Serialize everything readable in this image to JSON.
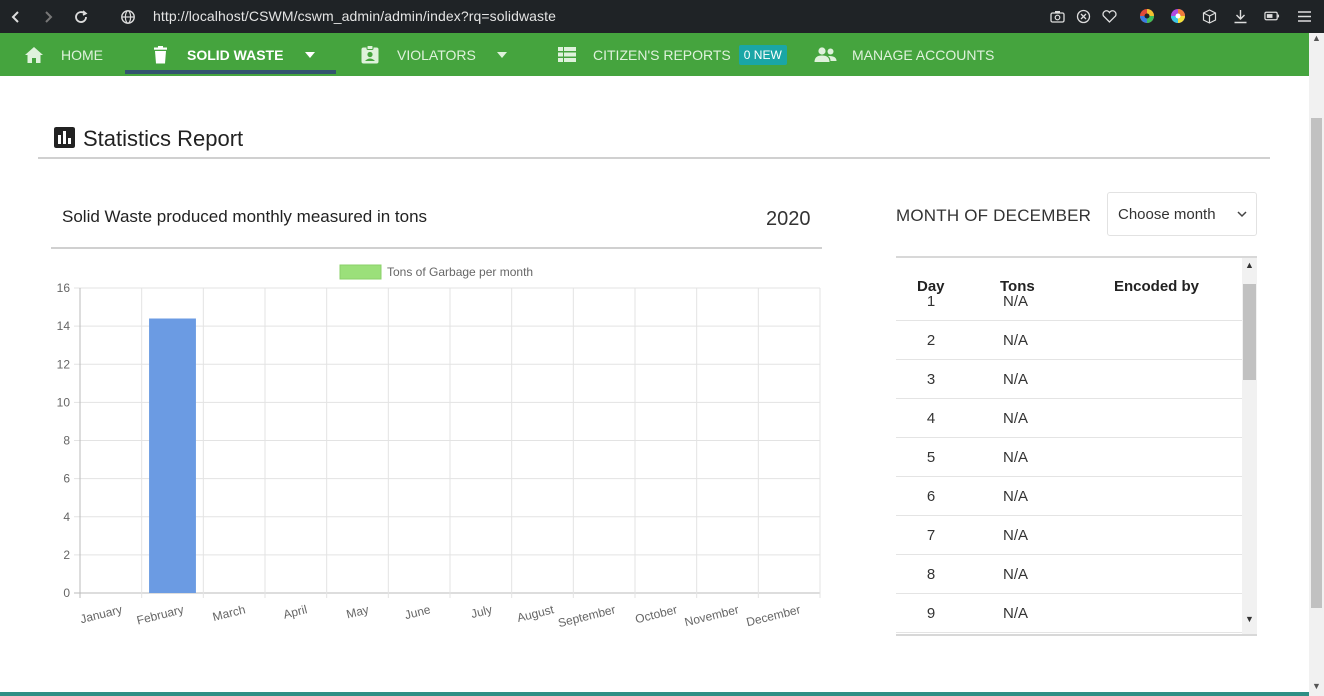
{
  "browser": {
    "url": "http://localhost/CSWM/cswm_admin/admin/index?rq=solidwaste"
  },
  "nav": {
    "items": [
      {
        "label": "HOME",
        "icon": "home-icon"
      },
      {
        "label": "SOLID WASTE",
        "icon": "trash-icon",
        "active": true,
        "dropdown": true
      },
      {
        "label": "VIOLATORS",
        "icon": "id-badge-icon",
        "dropdown": true
      },
      {
        "label": "CITIZEN'S REPORTS",
        "icon": "table-icon",
        "badge": "0 NEW"
      },
      {
        "label": "MANAGE ACCOUNTS",
        "icon": "users-icon"
      }
    ],
    "colors": {
      "bar": "#45a43e",
      "active_underline": "#33546e",
      "badge": "#1aa6a6"
    }
  },
  "page": {
    "title": "Statistics Report",
    "title_icon": "bar-chart-icon"
  },
  "chart_card": {
    "title": "Solid Waste produced monthly measured in tons",
    "year": "2020"
  },
  "chart_data": {
    "type": "bar",
    "categories": [
      "January",
      "February",
      "March",
      "April",
      "May",
      "June",
      "July",
      "August",
      "September",
      "October",
      "November",
      "December"
    ],
    "series": [
      {
        "name": "Tons of Garbage per month",
        "values": [
          0,
          14.4,
          0,
          0,
          0,
          0,
          0,
          0,
          0,
          0,
          0,
          0
        ],
        "color": "#6b9be3",
        "legend_color": "#9be07a"
      }
    ],
    "ylim": [
      0,
      16
    ],
    "yticks": [
      0,
      2,
      4,
      6,
      8,
      10,
      12,
      14,
      16
    ],
    "grid": true,
    "legend_position": "top"
  },
  "month_panel": {
    "heading": "MONTH OF DECEMBER",
    "select_value": "Choose month",
    "columns": [
      "Day",
      "Tons",
      "Encoded by"
    ],
    "rows": [
      {
        "day": "1",
        "tons": "N/A",
        "encoded_by": ""
      },
      {
        "day": "2",
        "tons": "N/A",
        "encoded_by": ""
      },
      {
        "day": "3",
        "tons": "N/A",
        "encoded_by": ""
      },
      {
        "day": "4",
        "tons": "N/A",
        "encoded_by": ""
      },
      {
        "day": "5",
        "tons": "N/A",
        "encoded_by": ""
      },
      {
        "day": "6",
        "tons": "N/A",
        "encoded_by": ""
      },
      {
        "day": "7",
        "tons": "N/A",
        "encoded_by": ""
      },
      {
        "day": "8",
        "tons": "N/A",
        "encoded_by": ""
      },
      {
        "day": "9",
        "tons": "N/A",
        "encoded_by": ""
      }
    ]
  }
}
